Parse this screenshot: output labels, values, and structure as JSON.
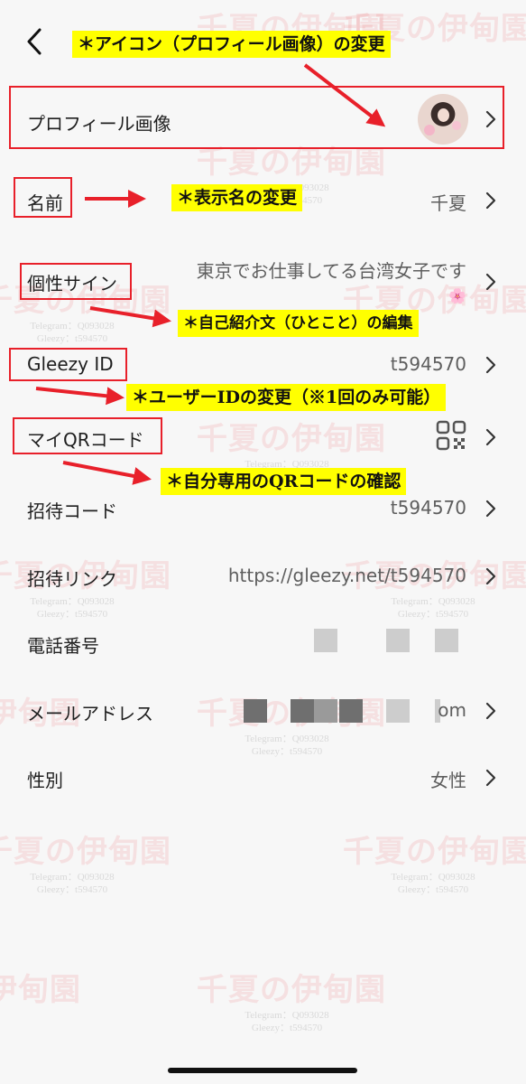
{
  "watermark": {
    "title": "千夏の伊甸園",
    "line1": "Telegram：Q093028",
    "line2": "Gleezy：t594570"
  },
  "annotations": {
    "avatar_note": "＊アイコン（プロフィール画像）の変更",
    "name_note": "＊表示名の変更",
    "bio_note": "＊自己紹介文（ひとこと）の編集",
    "id_note": "＊ユーザーIDの変更（※1回のみ可能）",
    "qr_note": "＊自分専用のQRコードの確認"
  },
  "rows": {
    "profile_image": {
      "label": "プロフィール画像"
    },
    "name": {
      "label": "名前",
      "value": "千夏"
    },
    "signature": {
      "label": "個性サイン",
      "value": "東京でお仕事してる台湾女子です",
      "emoji": "🌸"
    },
    "gleezy_id": {
      "label": "Gleezy ID",
      "value": "t594570"
    },
    "my_qr": {
      "label": "マイQRコード"
    },
    "invite_code": {
      "label": "招待コード",
      "value": "t594570"
    },
    "invite_link": {
      "label": "招待リンク",
      "value": "https://gleezy.net/t594570"
    },
    "phone": {
      "label": "電話番号"
    },
    "email": {
      "label": "メールアドレス",
      "value_tail": "om"
    },
    "gender": {
      "label": "性別",
      "value": "女性"
    }
  },
  "icons": {
    "back": "chevron-left-icon",
    "row_chevron": "chevron-right-icon",
    "qr": "qr-code-icon"
  },
  "colors": {
    "annotation_red": "#e8202a",
    "highlight_yellow": "#ffff00",
    "background": "#f7f7f7"
  }
}
